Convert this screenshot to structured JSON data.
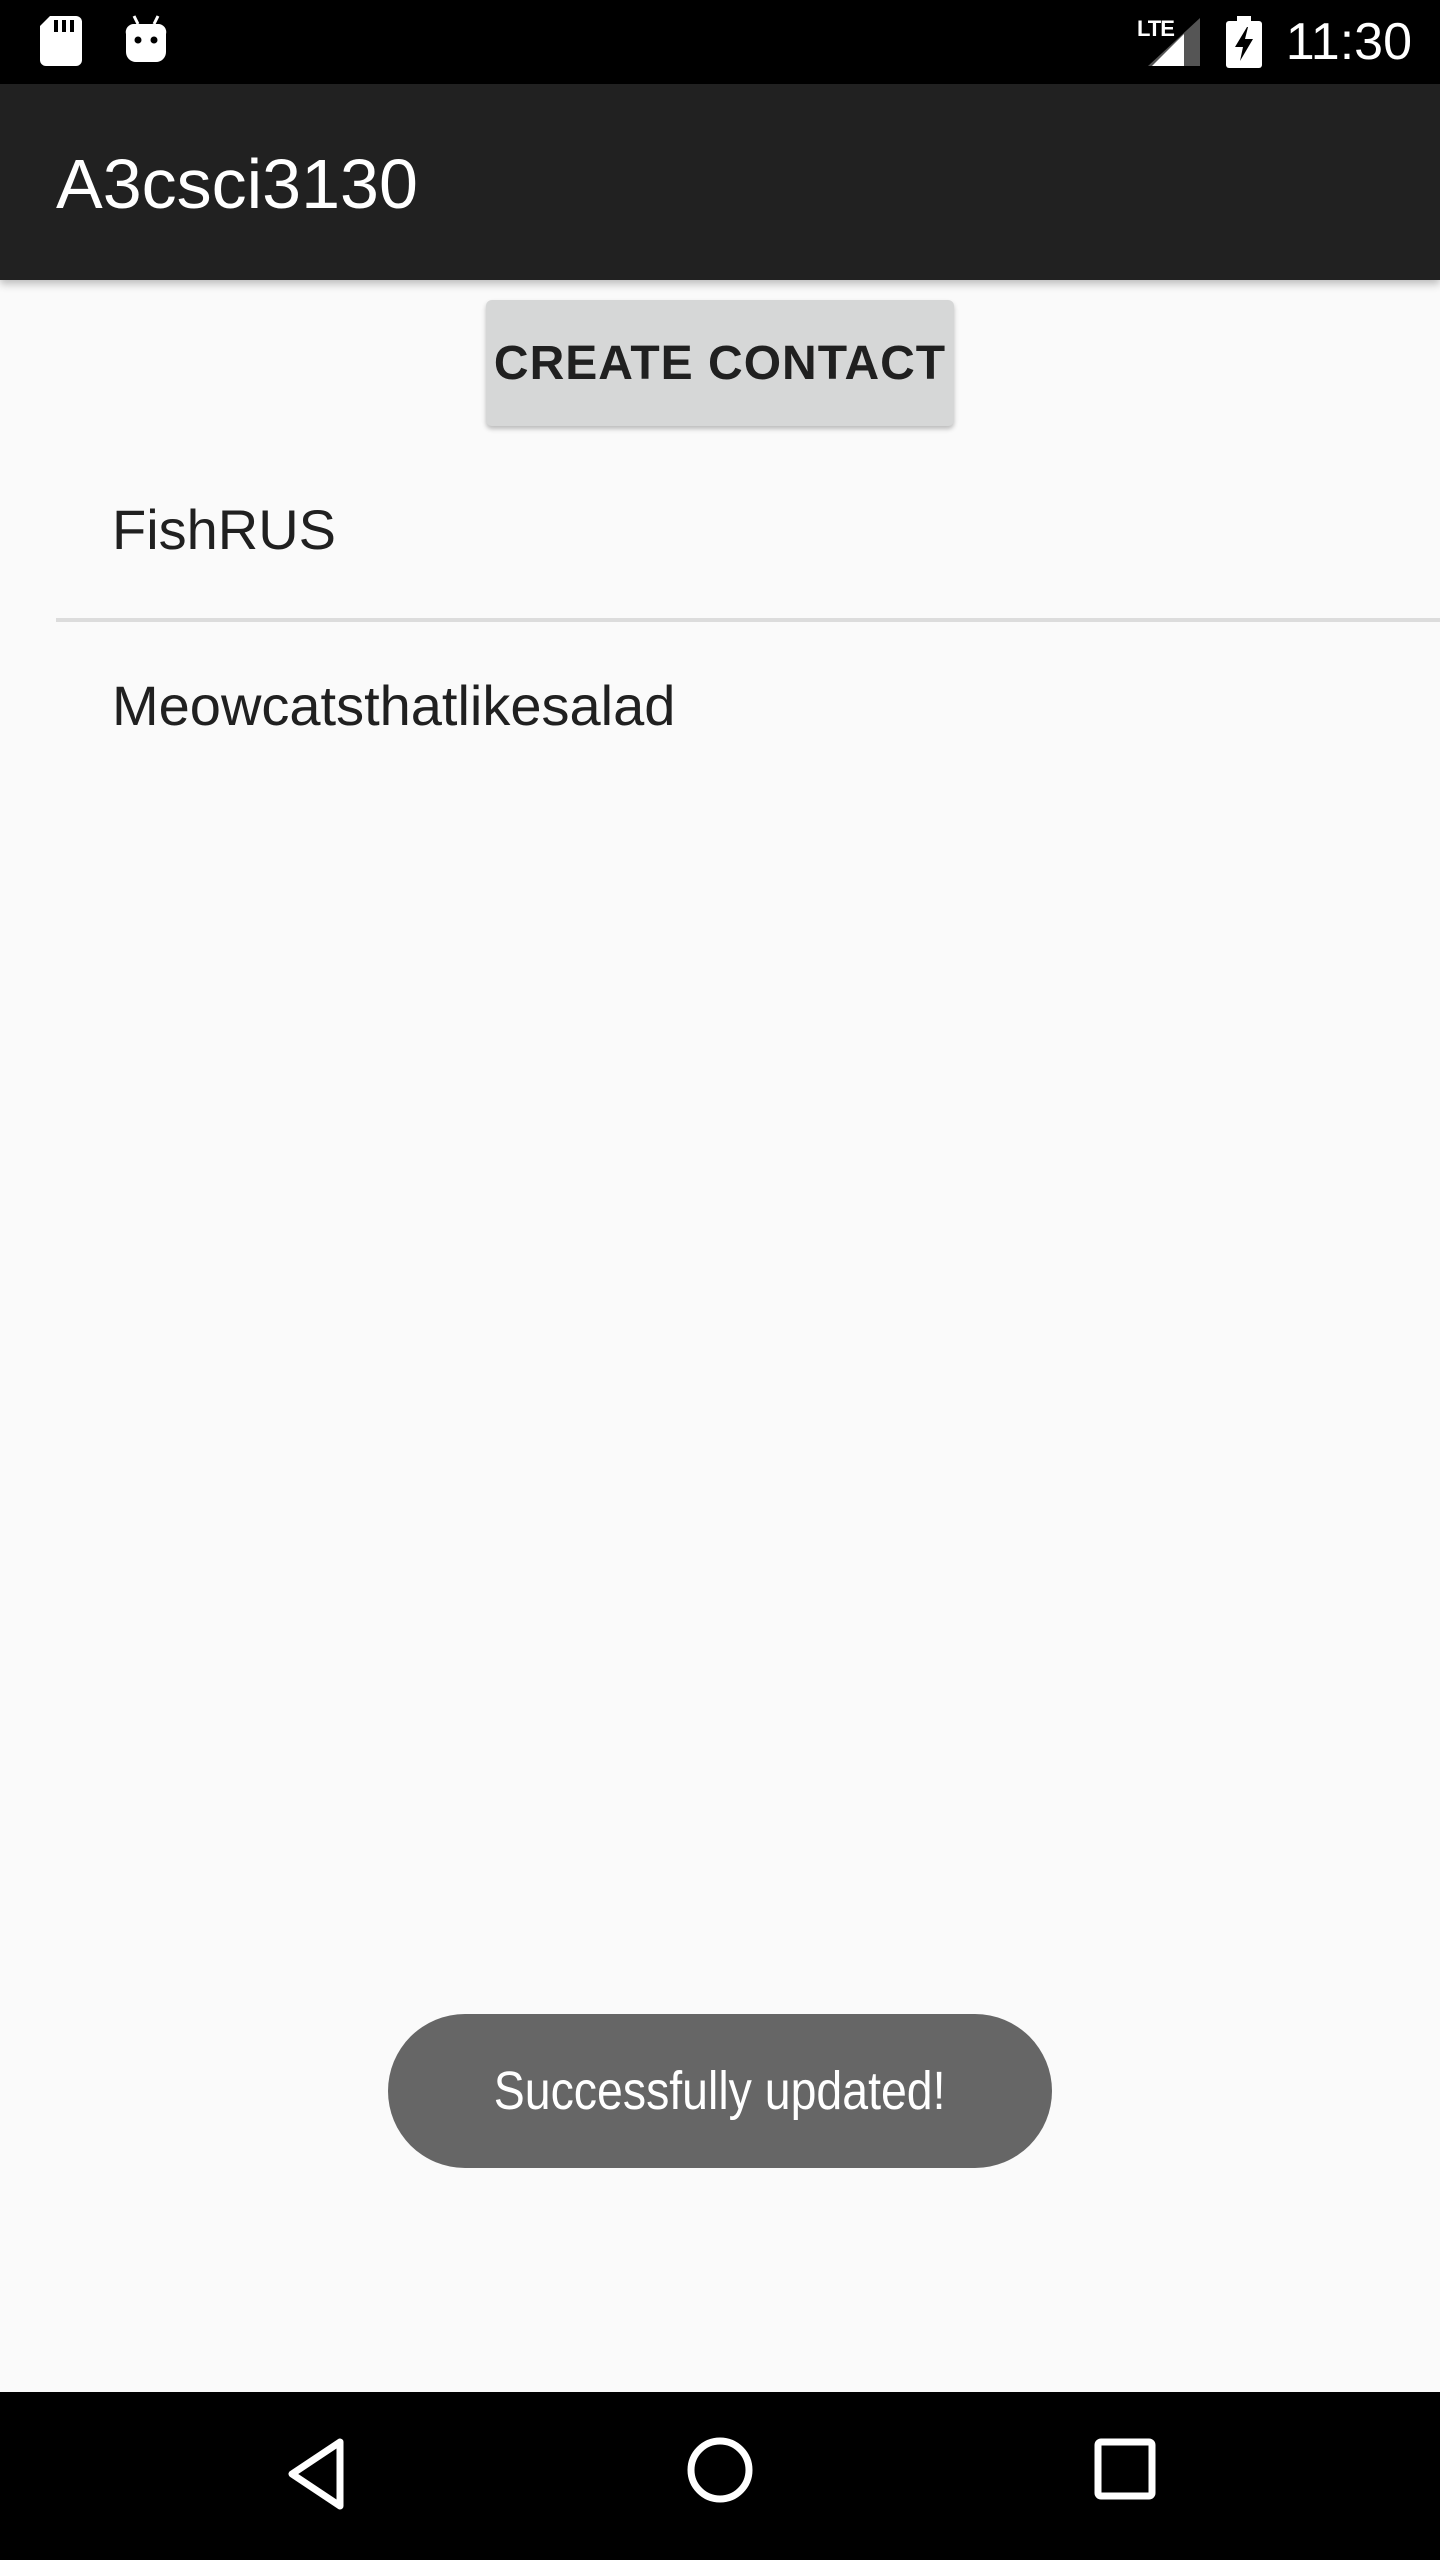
{
  "status_bar": {
    "time": "11:30",
    "network": "LTE",
    "icons": [
      "sd-card-icon",
      "android-debug-icon",
      "signal-icon",
      "battery-charging-icon"
    ]
  },
  "toolbar": {
    "title": "A3csci3130"
  },
  "main": {
    "create_button_label": "CREATE CONTACT",
    "contacts": [
      "FishRUS",
      "Meowcatsthatlikesalad"
    ]
  },
  "toast": {
    "message": "Successfully updated!"
  },
  "nav_bar": {
    "icons": [
      "back-icon",
      "home-icon",
      "recents-icon"
    ]
  },
  "colors": {
    "status_bar": "#000000",
    "toolbar": "#212121",
    "background": "#fafafa",
    "button": "#d6d7d7",
    "toast": "#666666"
  }
}
